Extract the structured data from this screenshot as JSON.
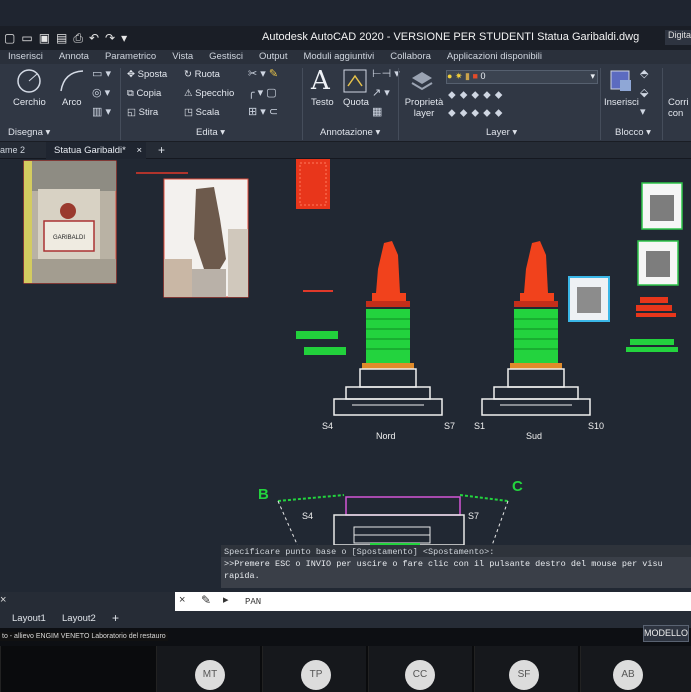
{
  "titlebar": {
    "title": "Autodesk AutoCAD 2020 - VERSIONE PER STUDENTI    Statua Garibaldi.dwg",
    "signin": "Digita"
  },
  "ribbon_tabs": [
    "Inserisci",
    "Annota",
    "Parametrico",
    "Vista",
    "Gestisci",
    "Output",
    "Moduli aggiuntivi",
    "Collabora",
    "Applicazioni disponibili"
  ],
  "ribbon": {
    "disegna": {
      "cerchio": "Cerchio",
      "arco": "Arco",
      "label": "Disegna"
    },
    "edita": {
      "sposta": "Sposta",
      "ruota": "Ruota",
      "copia": "Copia",
      "specchio": "Specchio",
      "stira": "Stira",
      "scala": "Scala",
      "label": "Edita"
    },
    "annotazione": {
      "testo": "Testo",
      "quota": "Quota",
      "label": "Annotazione"
    },
    "layer": {
      "proprieta": "Proprietà layer",
      "current": "0",
      "label": "Layer"
    },
    "blocco": {
      "inserisci": "Inserisci",
      "label": "Blocco"
    },
    "corr": "Corri con"
  },
  "doctabs": {
    "left_stub": "ame 2",
    "active": "Statua Garibaldi*",
    "close": "×",
    "add": "+"
  },
  "drawing": {
    "labels": {
      "s4": "S4",
      "nord": "Nord",
      "s7": "S7",
      "s1": "S1",
      "sud": "Sud",
      "s10": "S10",
      "b": "B",
      "c": "C",
      "s4b": "S4",
      "s7b": "S7"
    },
    "photo_plaque_text": "GARIBALDI"
  },
  "command": {
    "line1": "Specificare punto base o [Spostamento] <Spostamento>:",
    "line2": ">>Premere ESC o INVIO per uscire o fare clic con il pulsante destro del mouse per visu",
    "line3": "rapida.",
    "input": "PAN"
  },
  "layout_tabs": {
    "layout1": "Layout1",
    "layout2": "Layout2",
    "add": "+"
  },
  "status": {
    "left_text": "to - allievo ENGIM VENETO Laboratorio del restauro",
    "model": "MODELLO"
  },
  "participants": [
    {
      "initials": "MT"
    },
    {
      "initials": "TP"
    },
    {
      "initials": "CC"
    },
    {
      "initials": "SF"
    },
    {
      "initials": "AB"
    }
  ]
}
